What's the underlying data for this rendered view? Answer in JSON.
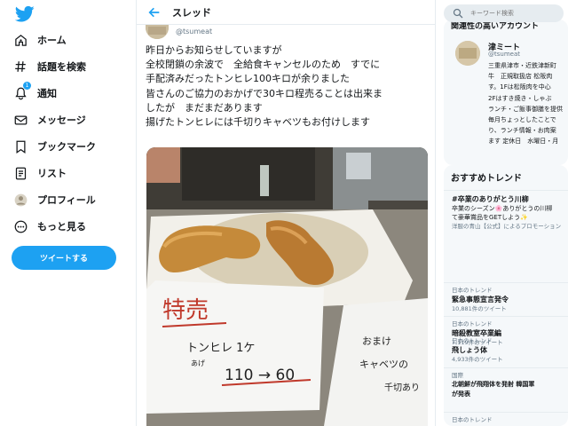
{
  "nav": {
    "items": [
      {
        "label": "ホーム",
        "icon": "home-icon"
      },
      {
        "label": "話題を検索",
        "icon": "hashtag-icon"
      },
      {
        "label": "通知",
        "icon": "bell-icon",
        "badge": "1"
      },
      {
        "label": "メッセージ",
        "icon": "mail-icon"
      },
      {
        "label": "ブックマーク",
        "icon": "bookmark-icon"
      },
      {
        "label": "リスト",
        "icon": "list-icon"
      },
      {
        "label": "プロフィール",
        "icon": "profile-icon"
      },
      {
        "label": "もっと見る",
        "icon": "more-icon"
      }
    ],
    "tweet_button": "ツイートする"
  },
  "thread": {
    "title": "スレッド",
    "handle": "@tsumeat",
    "text_lines": [
      "昨日からお知らせしていますが",
      "全校閉鎖の余波で　全給食キャンセルのため　すでに",
      "手配済みだったトンヒレ100キロが余りました",
      "皆さんのご協力のおかげで30キロ程売ることは出来ま",
      "したが　まだまだあります",
      "揚げたトンヒレには千切りキャベツもお付けします"
    ],
    "photo": {
      "sign_title": "特売",
      "sign_item": "トンヒレ 1ケ",
      "sign_small": "あげ",
      "sign_price": "110 → 60",
      "sign2_lines": [
        "おまけ",
        "キャベツの",
        "千切あり"
      ]
    }
  },
  "search": {
    "placeholder": "キーワード検索"
  },
  "related": {
    "title": "関連性の高いアカウント",
    "name": "津ミート",
    "handle": "@tsumeat",
    "bio_lines": [
      "三重県津市・近鉄津新町",
      "牛　正規取扱店 松阪肉",
      "す。1Fは松阪肉を中心",
      "2Fはすき焼き・しゃぶ",
      "ランチ・ご飯事御膳を提供",
      "毎月ちょっとしたことで",
      "り、ランチ情報・お肉案",
      "ます 定休日　水曜日・月"
    ]
  },
  "trends": {
    "title": "おすすめトレンド",
    "items": [
      {
        "name": "#卒業のありがとう川柳",
        "desc": "卒業のシーズン🌸ありがとうの川柳",
        "desc2": "て豪華賞品をGETしよう✨",
        "promo": "洋服の青山【公式】によるプロモーション"
      },
      {
        "meta": "日本のトレンド",
        "name": "緊急事態宣言発令",
        "count": "10,881件のツイート"
      },
      {
        "meta": "日本のトレンド",
        "name": "暗殺教室卒業編",
        "count": "7,119件のツイート"
      },
      {
        "meta": "日本のトレンド",
        "name": "飛しょう体",
        "count": "4,933件のツイート"
      },
      {
        "meta": "国際",
        "name": "北朝鮮が飛翔体を発射 韓国軍",
        "count": "が発表"
      },
      {
        "meta": "日本のトレンド"
      }
    ]
  },
  "colors": {
    "accent": "#1da1f2",
    "text": "#14171a",
    "muted": "#657786",
    "panel": "#f5f8fa"
  }
}
